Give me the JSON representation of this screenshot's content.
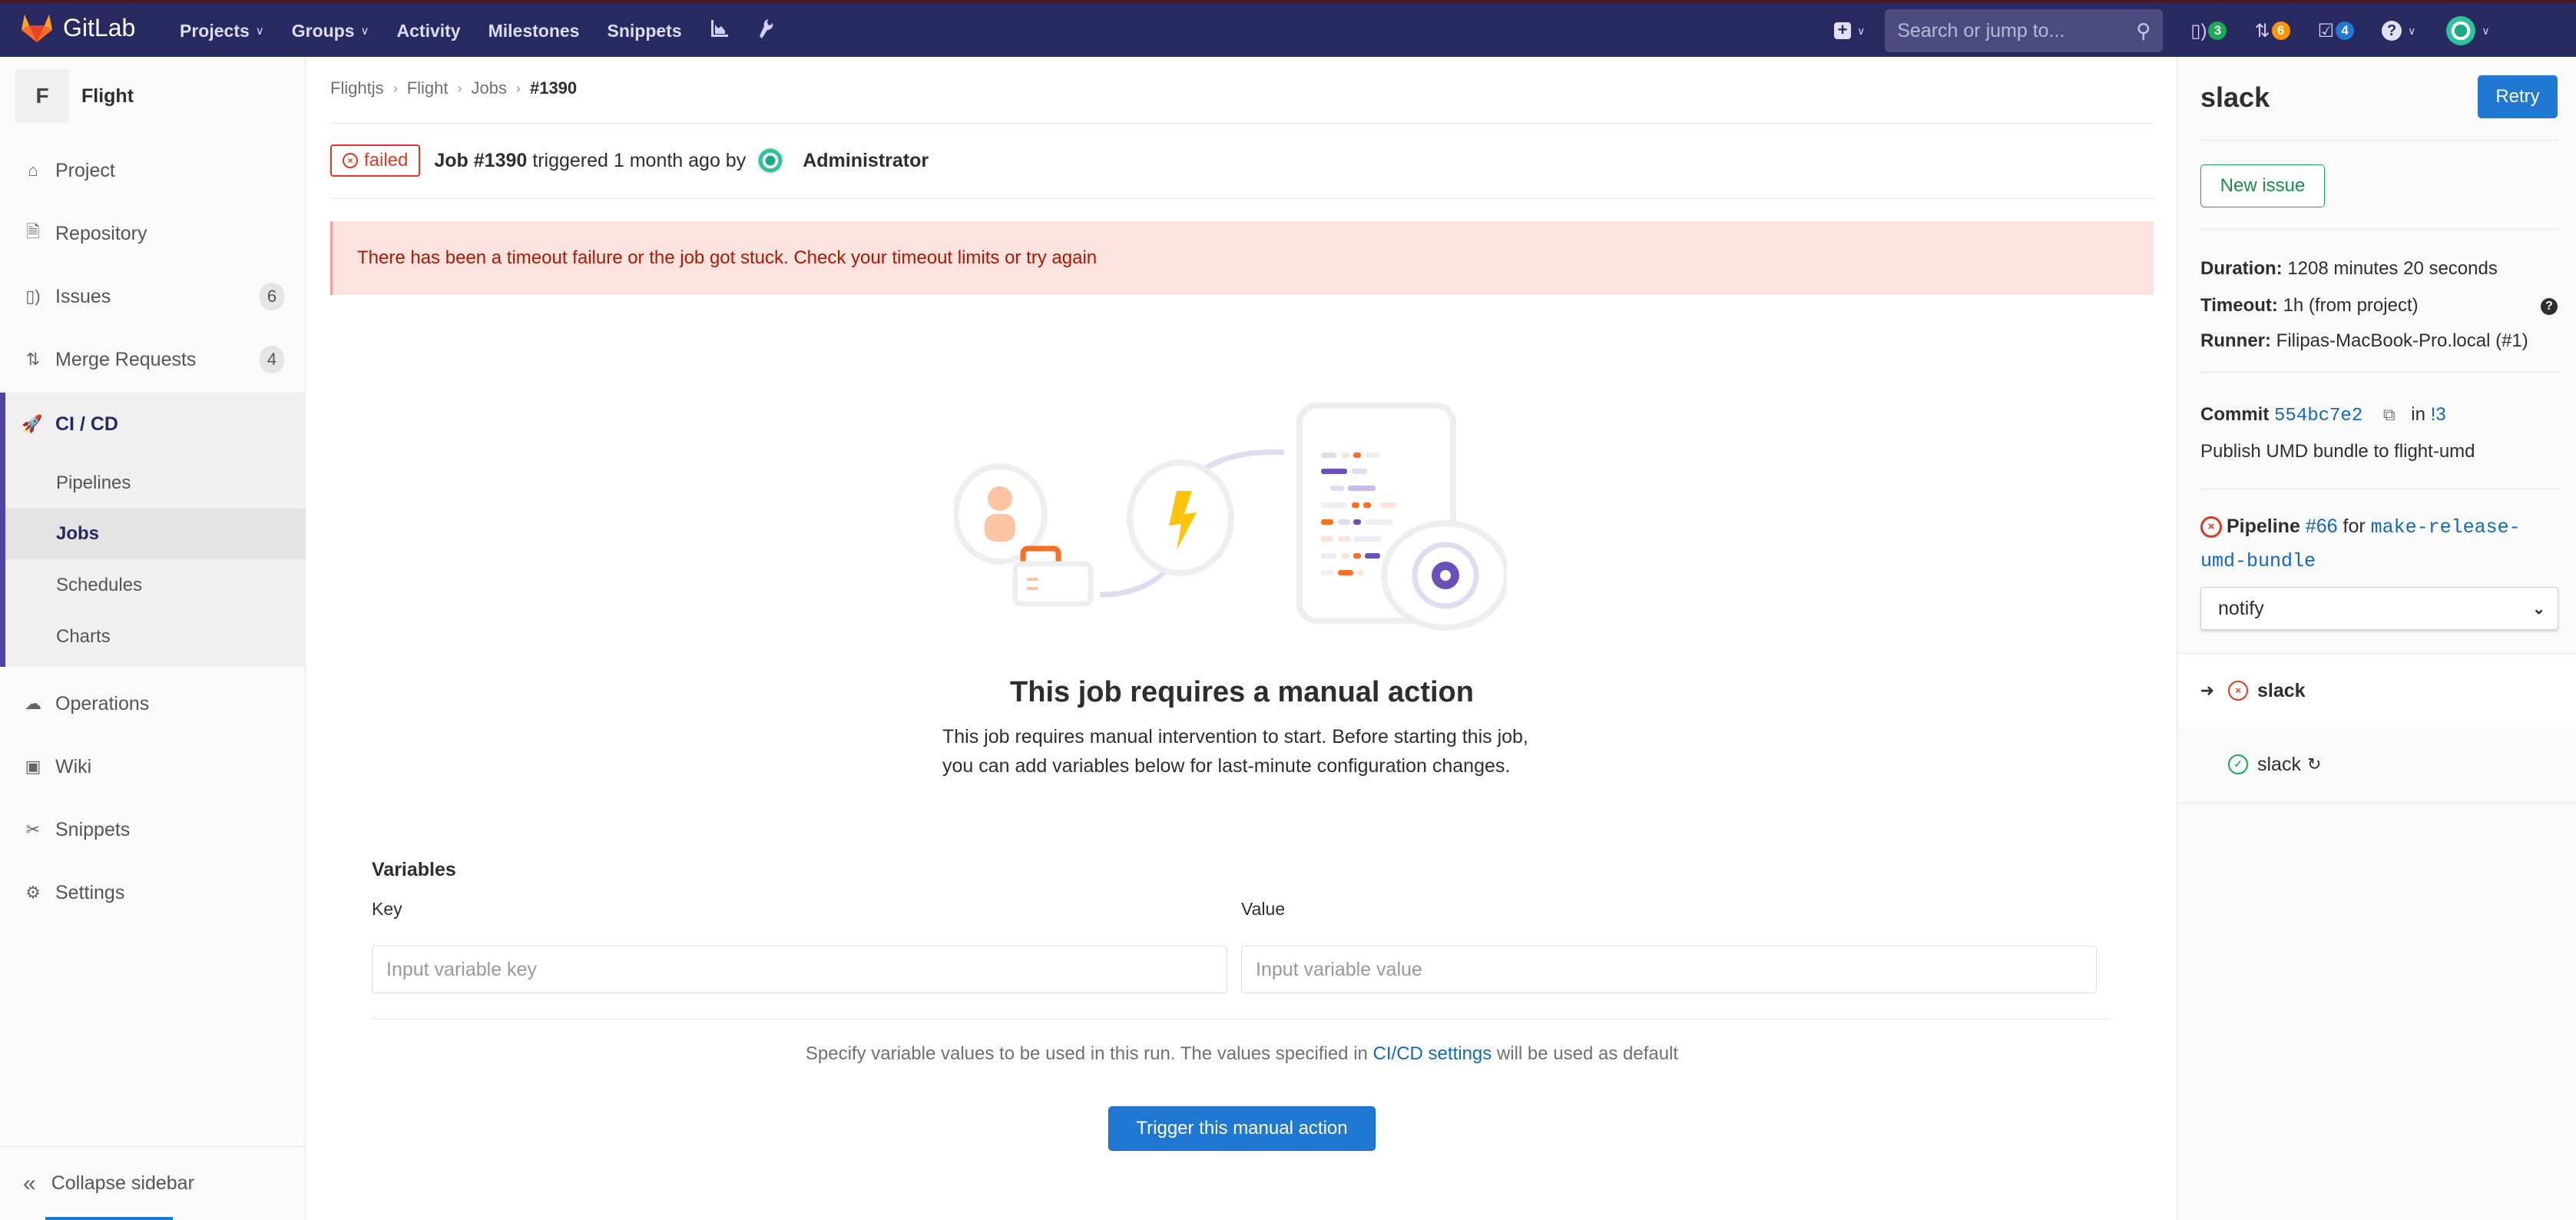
{
  "topnav": {
    "brand": "GitLab",
    "links": [
      {
        "label": "Projects",
        "has_dropdown": true
      },
      {
        "label": "Groups",
        "has_dropdown": true
      },
      {
        "label": "Activity",
        "has_dropdown": false
      },
      {
        "label": "Milestones",
        "has_dropdown": false
      },
      {
        "label": "Snippets",
        "has_dropdown": false
      }
    ],
    "icons": [
      "chart-icon",
      "wrench-icon"
    ],
    "search_placeholder": "Search or jump to...",
    "counters": {
      "issues": {
        "count": "3",
        "color": "#1aaa55"
      },
      "merge_requests": {
        "count": "6",
        "color": "#fc9403"
      },
      "todos": {
        "count": "4",
        "color": "#1f78d1"
      }
    },
    "caret": "⌄"
  },
  "sidebar": {
    "project_initial": "F",
    "project_name": "Flight",
    "items": [
      {
        "label": "Project",
        "icon": "home-icon"
      },
      {
        "label": "Repository",
        "icon": "doc-icon"
      },
      {
        "label": "Issues",
        "icon": "issues-icon",
        "count": "6"
      },
      {
        "label": "Merge Requests",
        "icon": "merge-request-icon",
        "count": "4"
      }
    ],
    "cicd": {
      "label": "CI / CD",
      "subitems": [
        "Pipelines",
        "Jobs",
        "Schedules",
        "Charts"
      ],
      "active": "Jobs"
    },
    "items_after": [
      {
        "label": "Operations",
        "icon": "cloud-gear-icon"
      },
      {
        "label": "Wiki",
        "icon": "book-icon"
      },
      {
        "label": "Snippets",
        "icon": "scissors-icon"
      },
      {
        "label": "Settings",
        "icon": "gear-icon"
      }
    ],
    "collapse_label": "Collapse sidebar"
  },
  "breadcrumb": [
    "Flightjs",
    "Flight",
    "Jobs",
    "#1390"
  ],
  "job_header": {
    "status": "failed",
    "job_label": "Job #1390",
    "triggered_text": "triggered 1 month ago by",
    "user": "Administrator"
  },
  "alert": "There has been a timeout failure or the job got stuck. Check your timeout limits or try again",
  "empty_state": {
    "title": "This job requires a manual action",
    "description": "This job requires manual intervention to start. Before starting this job, you can add variables below for last-minute configuration changes."
  },
  "variables": {
    "title": "Variables",
    "key_label": "Key",
    "value_label": "Value",
    "key_placeholder": "Input variable key",
    "value_placeholder": "Input variable value",
    "help_before": "Specify variable values to be used in this run. The values specified in",
    "help_link": "CI/CD settings",
    "help_after": "will be used as default",
    "trigger_label": "Trigger this manual action"
  },
  "right_sidebar": {
    "job_name": "slack",
    "retry_label": "Retry",
    "new_issue_label": "New issue",
    "duration_label": "Duration:",
    "duration_value": "1208 minutes 20 seconds",
    "timeout_label": "Timeout:",
    "timeout_value": "1h (from project)",
    "runner_label": "Runner:",
    "runner_value": "Filipas-MacBook-Pro.local (#1)",
    "commit_label": "Commit",
    "commit_sha": "554bc7e2",
    "commit_in": "in",
    "commit_mr": "!3",
    "commit_message": "Publish UMD bundle to flight-umd",
    "pipeline_label": "Pipeline",
    "pipeline_id": "#66",
    "pipeline_for": "for",
    "pipeline_ref": "make-release-umd-bundle",
    "stage_selected": "notify",
    "jobs": [
      {
        "name": "slack",
        "status": "failed",
        "current": true,
        "retried": false
      },
      {
        "name": "slack",
        "status": "success",
        "current": false,
        "retried": true
      }
    ]
  }
}
